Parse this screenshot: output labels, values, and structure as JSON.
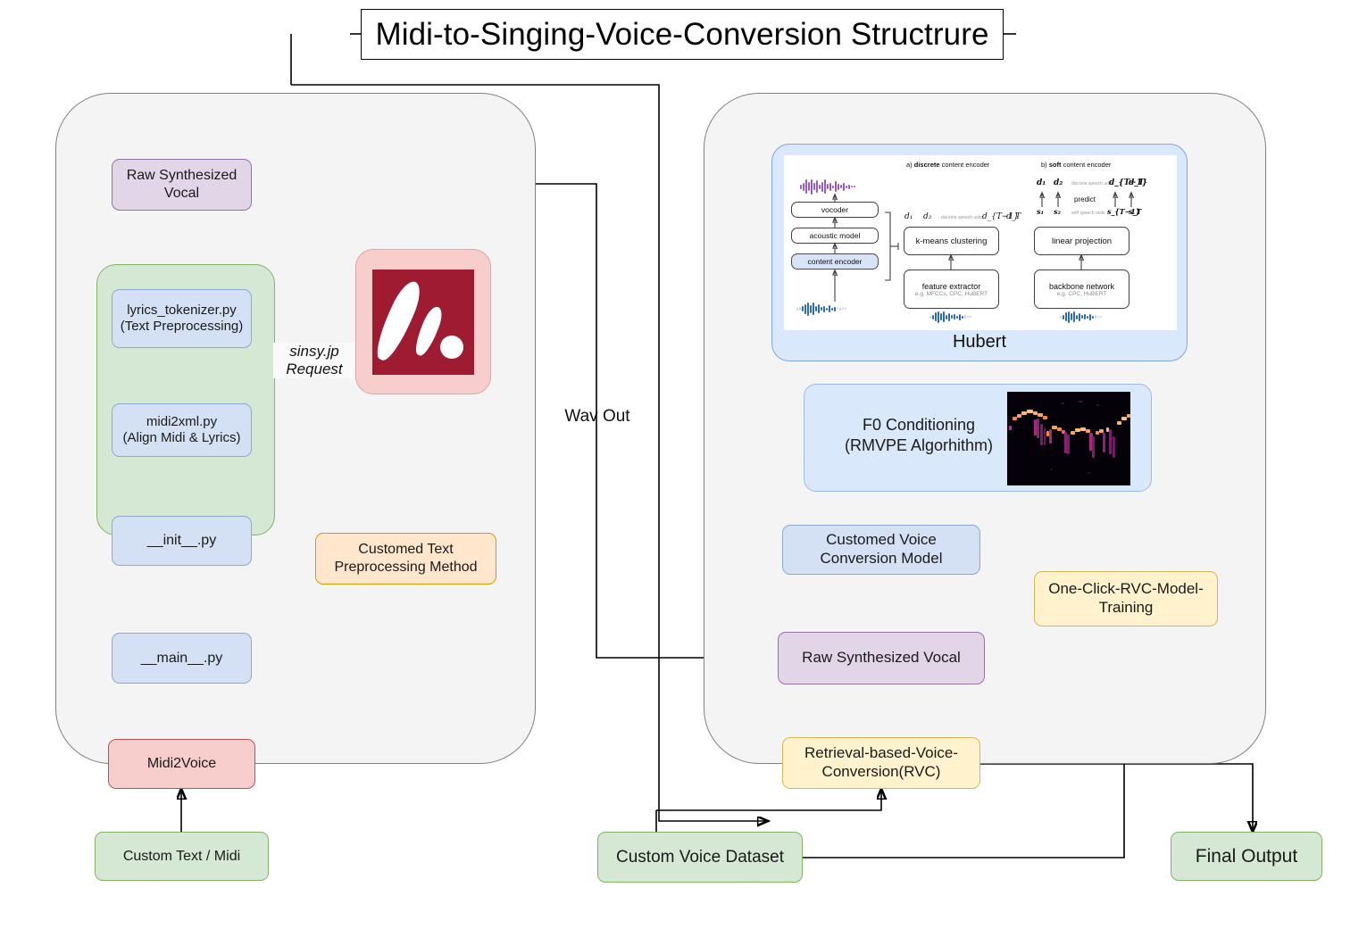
{
  "title": "Midi-to-Singing-Voice-Conversion Structrure",
  "left_pipeline": {
    "container_name": "midi2voice-container",
    "nodes": {
      "raw_synth_vocal": "Raw Synthesized\nVocal",
      "lyrics_tokenizer": "lyrics_tokenizer.py\n(Text Preprocessing)",
      "midi2xml": "midi2xml.py\n(Align Midi & Lyrics)",
      "init_py": "__init__.py",
      "main_py": "__main__.py",
      "midi2voice": "Midi2Voice",
      "custom_text_midi": "Custom Text / Midi",
      "customed_text_preproc": "Customed Text\nPreprocessing Method"
    },
    "edge_labels": {
      "sinsy_request": "sinsy.jp\nRequest",
      "wav_out": "Wav\nOut"
    },
    "logo": {
      "name": "sinsy-logo",
      "bg": "#9e1b32",
      "frame": "#f8cecc"
    }
  },
  "right_pipeline": {
    "container_name": "rvc-container",
    "hubert": {
      "caption": "Hubert",
      "panel_a_label_prefix": "a)",
      "panel_a_label_bold": "discrete",
      "panel_a_label_suffix": "content encoder",
      "panel_b_label_prefix": "b)",
      "panel_b_label_bold": "soft",
      "panel_b_label_suffix": "content encoder",
      "left_stack": [
        "vocoder",
        "acoustic model",
        "content encoder"
      ],
      "discrete_boxes": [
        {
          "main": "k-means clustering",
          "sub": ""
        },
        {
          "main": "feature extractor",
          "sub": "e.g. MFCCs, CPC, HuBERT"
        }
      ],
      "soft_boxes": [
        {
          "main": "linear projection",
          "sub": ""
        },
        {
          "main": "backbone network",
          "sub": "e.g. CPC, HuBERT"
        }
      ],
      "discrete_units_label": "discrete speech units",
      "soft_units_label": "soft speech units",
      "predict_label": "predict",
      "d_tokens": [
        "d₁",
        "d₂",
        "d_{T−1}",
        "d_T"
      ],
      "s_tokens": [
        "s₁",
        "s₂",
        "s_{T−1}",
        "s_T"
      ]
    },
    "nodes": {
      "f0_conditioning": "F0 Conditioning\n(RMVPE Algorhithm)",
      "customed_vc_model": "Customed Voice\nConversion Model",
      "raw_synth_vocal": "Raw Synthesized Vocal",
      "rvc": "Retrieval-based-Voice-\nConversion(RVC)",
      "one_click_training": "One-Click-RVC-Model-\nTraining",
      "custom_voice_dataset": "Custom Voice Dataset",
      "final_output": "Final Output"
    }
  },
  "palette": {
    "blue_fill": "#d4e1f5",
    "blue_stroke": "#8ea9d0",
    "green_fill": "#d5e8d4",
    "green_stroke": "#82b366",
    "purple_fill": "#e1d5e7",
    "purple_stroke": "#9673a6",
    "red_fill": "#f8cecc",
    "red_stroke": "#b85450",
    "orange_fill": "#ffe6cc",
    "orange_stroke": "#d79b00",
    "yellow_fill": "#fff2cc",
    "yellow_stroke": "#d6b656",
    "container_fill": "#f4f4f4",
    "container_stroke": "#808080"
  }
}
